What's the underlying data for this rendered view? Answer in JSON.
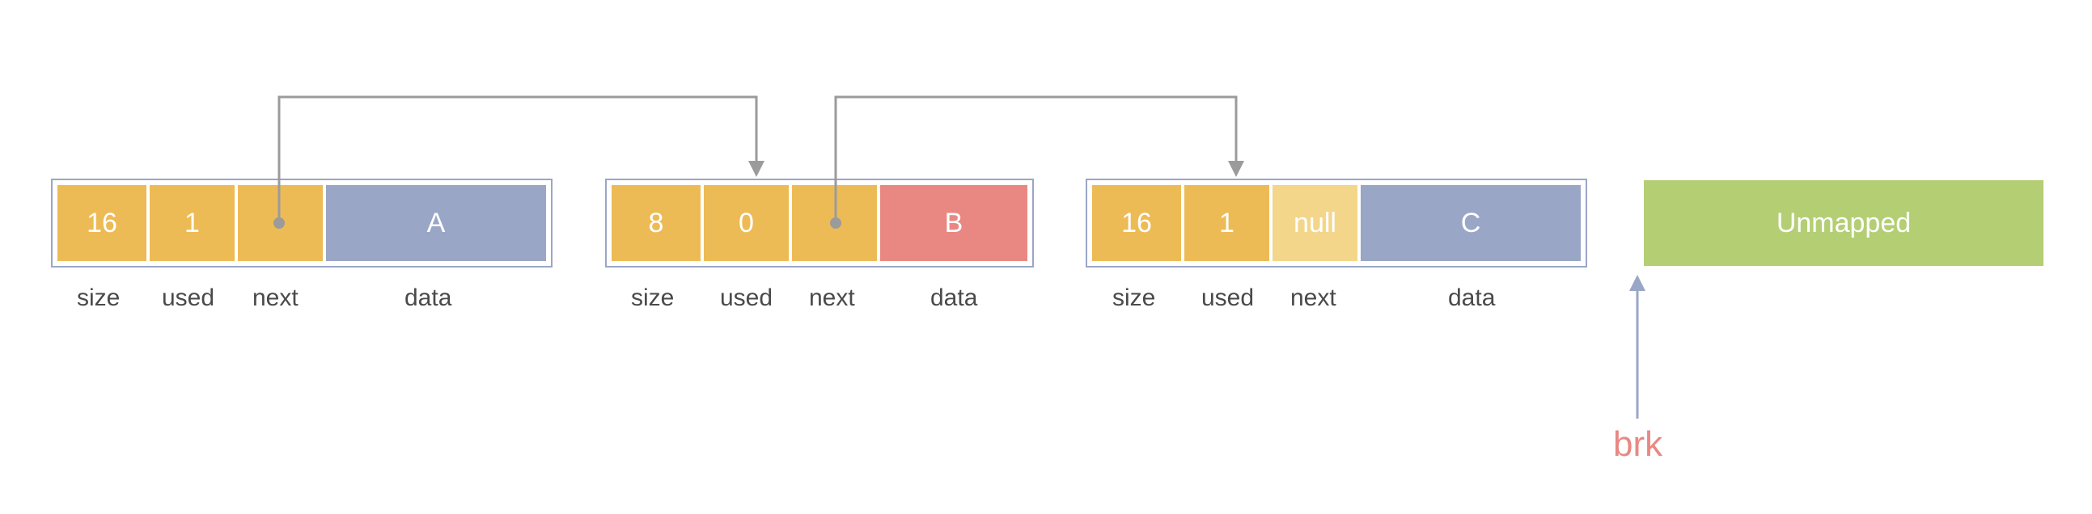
{
  "blocks": [
    {
      "size": "16",
      "used": "1",
      "next": "",
      "data": "A",
      "labels": {
        "size": "size",
        "used": "used",
        "next": "next",
        "data": "data"
      }
    },
    {
      "size": "8",
      "used": "0",
      "next": "",
      "data": "B",
      "labels": {
        "size": "size",
        "used": "used",
        "next": "next",
        "data": "data"
      }
    },
    {
      "size": "16",
      "used": "1",
      "next": "null",
      "data": "C",
      "labels": {
        "size": "size",
        "used": "used",
        "next": "next",
        "data": "data"
      }
    }
  ],
  "unmapped": "Unmapped",
  "brk": "brk"
}
